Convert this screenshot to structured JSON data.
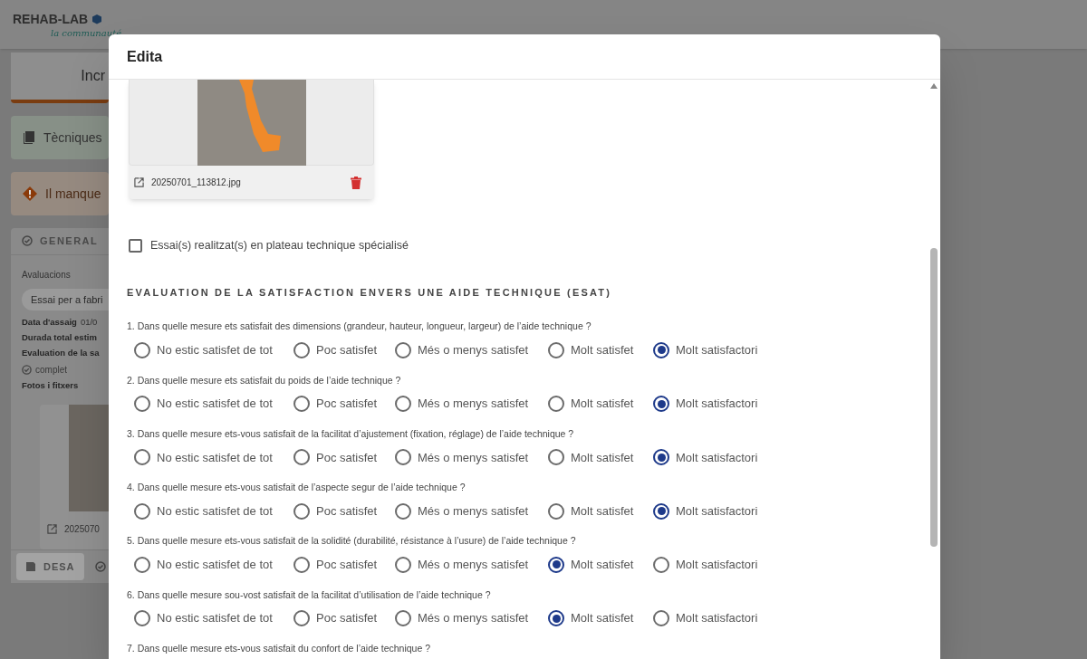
{
  "background": {
    "logo": {
      "name": "REHAB-LAB",
      "tagline": "la communauté"
    },
    "tab_card": {
      "label": "Incr"
    },
    "techniques_card": {
      "label": "Tècniques"
    },
    "warning_card": {
      "label": "Il manque"
    },
    "general_card": {
      "title": "GENERAL",
      "section_label": "Avaluacions",
      "chip": "Essai per a fabri",
      "fields": [
        {
          "kind": "label",
          "text": "Data d'assaig",
          "value": "01/0"
        },
        {
          "kind": "label",
          "text": "Durada total estim"
        },
        {
          "kind": "label",
          "text": "Evaluation de la sa"
        },
        {
          "kind": "status",
          "text": "complet"
        },
        {
          "kind": "label",
          "text": "Fotos i fitxers"
        }
      ],
      "file_name": "2025070",
      "save_button": {
        "label": "DESA",
        "disabled": true
      }
    }
  },
  "dialog": {
    "title": "Edita",
    "file_card": {
      "file_name": "20250701_113812.jpg"
    },
    "checkbox": {
      "label": "Essai(s) realitzat(s) en plateau technique spécialisé",
      "checked": false
    },
    "section_title": "EVALUATION DE LA SATISFACTION ENVERS UNE AIDE TECHNIQUE (ESAT)",
    "questions": [
      {
        "text": "1. Dans quelle mesure ets satisfait des dimensions (grandeur, hauteur, longueur, largeur) de l’aide technique ?",
        "options": [
          {
            "label": "No estic satisfet de tot",
            "selected": false
          },
          {
            "label": "Poc satisfet",
            "selected": false
          },
          {
            "label": "Més o menys satisfet",
            "selected": false
          },
          {
            "label": "Molt satisfet",
            "selected": false
          },
          {
            "label": "Molt satisfactori",
            "selected": true
          }
        ]
      },
      {
        "text": "2. Dans quelle mesure ets satisfait du poids de l’aide technique ?",
        "options": [
          {
            "label": "No estic satisfet de tot",
            "selected": false
          },
          {
            "label": "Poc satisfet",
            "selected": false
          },
          {
            "label": "Més o menys satisfet",
            "selected": false
          },
          {
            "label": "Molt satisfet",
            "selected": false
          },
          {
            "label": "Molt satisfactori",
            "selected": true
          }
        ]
      },
      {
        "text": "3. Dans quelle mesure ets-vous satisfait de la facilitat d’ajustement (fixation, réglage) de l’aide technique ?",
        "options": [
          {
            "label": "No estic satisfet de tot",
            "selected": false
          },
          {
            "label": "Poc satisfet",
            "selected": false
          },
          {
            "label": "Més o menys satisfet",
            "selected": false
          },
          {
            "label": "Molt satisfet",
            "selected": false
          },
          {
            "label": "Molt satisfactori",
            "selected": true
          }
        ]
      },
      {
        "text": "4. Dans quelle mesure ets-vous satisfait de l’aspecte segur de l’aide technique ?",
        "options": [
          {
            "label": "No estic satisfet de tot",
            "selected": false
          },
          {
            "label": "Poc satisfet",
            "selected": false
          },
          {
            "label": "Més o menys satisfet",
            "selected": false
          },
          {
            "label": "Molt satisfet",
            "selected": false
          },
          {
            "label": "Molt satisfactori",
            "selected": true
          }
        ]
      },
      {
        "text": "5. Dans quelle mesure ets-vous satisfait de la solidité (durabilité, résistance à l’usure) de l’aide technique ?",
        "options": [
          {
            "label": "No estic satisfet de tot",
            "selected": false
          },
          {
            "label": "Poc satisfet",
            "selected": false
          },
          {
            "label": "Més o menys satisfet",
            "selected": false
          },
          {
            "label": "Molt satisfet",
            "selected": true
          },
          {
            "label": "Molt satisfactori",
            "selected": false
          }
        ]
      },
      {
        "text": "6. Dans quelle mesure sou-vost satisfait de la facilitat d’utilisation de l’aide technique ?",
        "options": [
          {
            "label": "No estic satisfet de tot",
            "selected": false
          },
          {
            "label": "Poc satisfet",
            "selected": false
          },
          {
            "label": "Més o menys satisfet",
            "selected": false
          },
          {
            "label": "Molt satisfet",
            "selected": true
          },
          {
            "label": "Molt satisfactori",
            "selected": false
          }
        ]
      },
      {
        "text": "7. Dans quelle mesure ets-vous satisfait du confort de l’aide technique ?"
      }
    ]
  }
}
